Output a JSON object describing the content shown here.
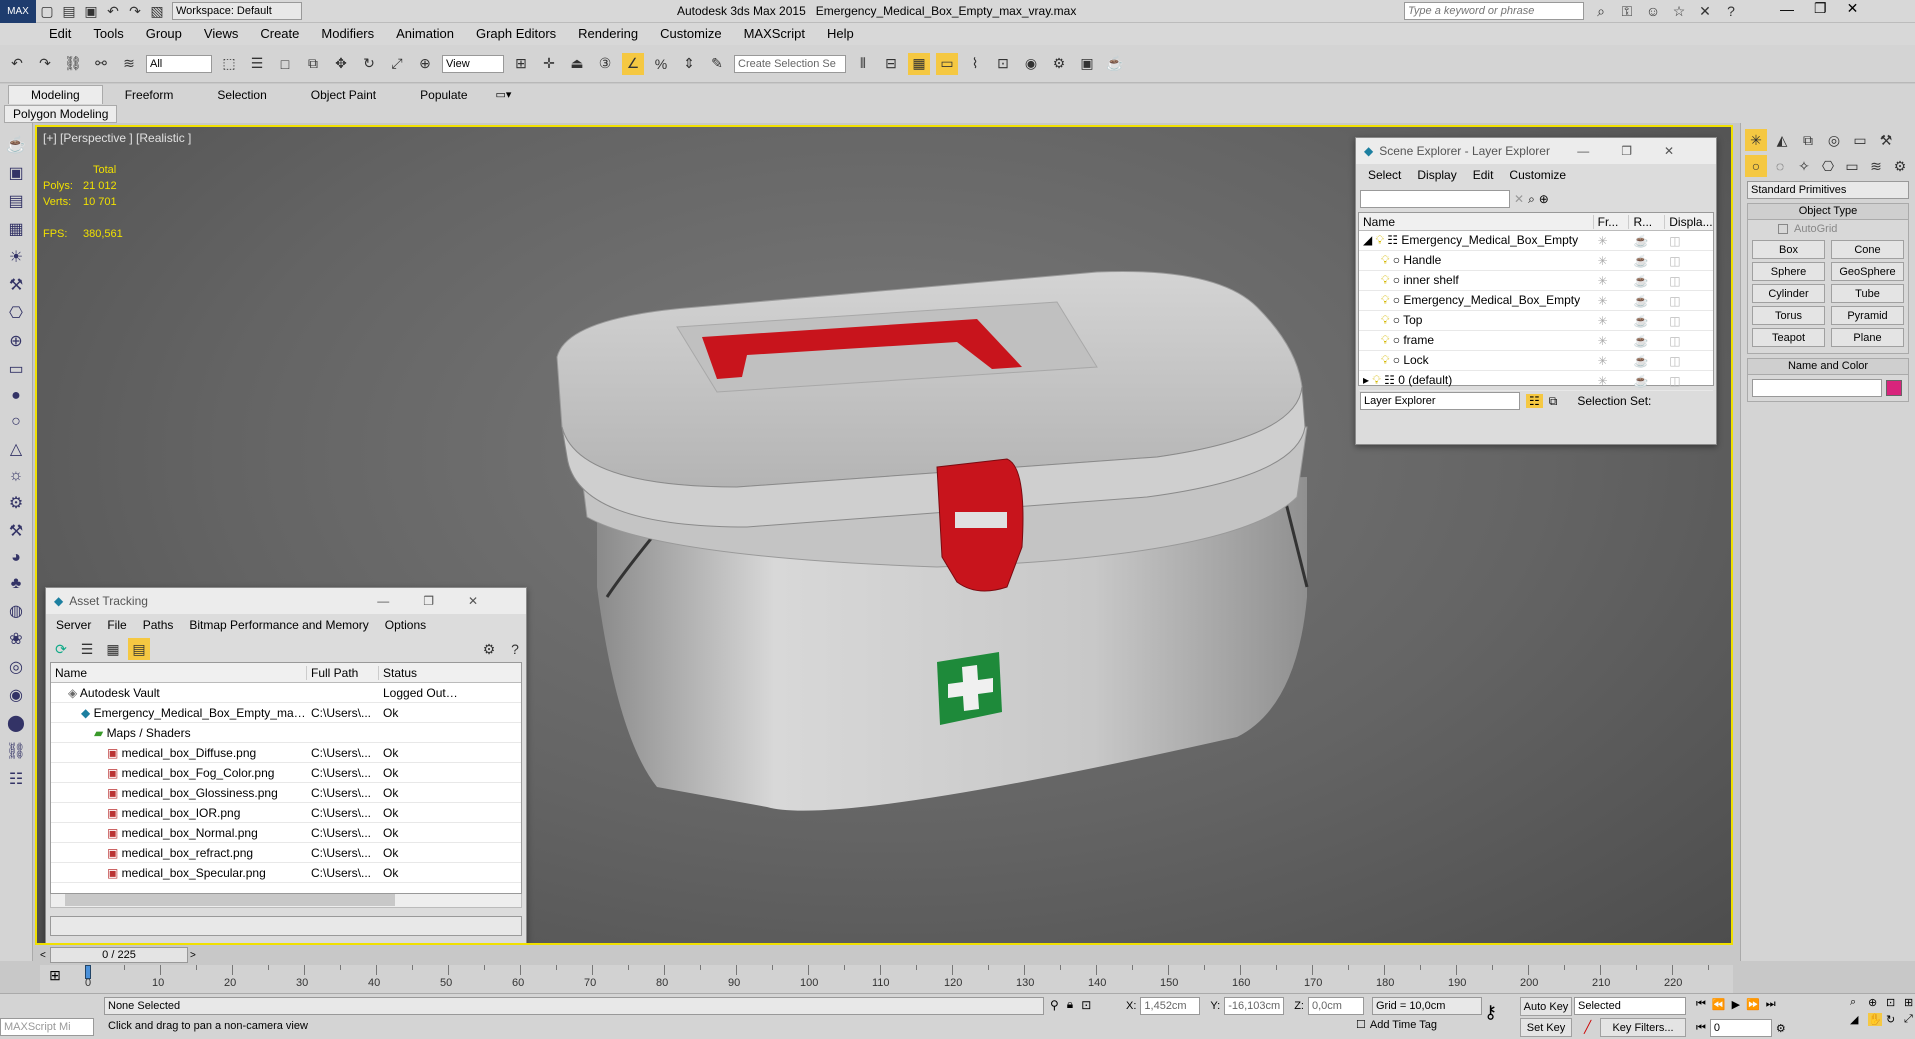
{
  "title_bar": {
    "workspace": "Workspace: Default",
    "app_title": "Autodesk 3ds Max  2015",
    "file_name": "Emergency_Medical_Box_Empty_max_vray.max",
    "search_placeholder": "Type a keyword or phrase"
  },
  "menu": [
    "Edit",
    "Tools",
    "Group",
    "Views",
    "Create",
    "Modifiers",
    "Animation",
    "Graph Editors",
    "Rendering",
    "Customize",
    "MAXScript",
    "Help"
  ],
  "main_toolbar": {
    "selection_filter": "All",
    "ref_coord": "View",
    "selection_set_placeholder": "Create Selection Se"
  },
  "ribbon": {
    "tabs": [
      "Modeling",
      "Freeform",
      "Selection",
      "Object Paint",
      "Populate"
    ],
    "subtab": "Polygon Modeling"
  },
  "viewport": {
    "label": "[+] [Perspective ] [Realistic ]",
    "stats": {
      "total_label": "Total",
      "polys_label": "Polys:",
      "polys": "21 012",
      "verts_label": "Verts:",
      "verts": "10 701",
      "fps_label": "FPS:",
      "fps": "380,561"
    }
  },
  "scene_explorer": {
    "title": "Scene Explorer - Layer Explorer",
    "menu": [
      "Select",
      "Display",
      "Edit",
      "Customize"
    ],
    "columns": [
      "Name",
      "Fr...",
      "R...",
      "Displa..."
    ],
    "rows": [
      {
        "name": "Emergency_Medical_Box_Empty",
        "level": 0
      },
      {
        "name": "Handle",
        "level": 1
      },
      {
        "name": "inner shelf",
        "level": 1
      },
      {
        "name": "Emergency_Medical_Box_Empty",
        "level": 1
      },
      {
        "name": "Top",
        "level": 1
      },
      {
        "name": "frame",
        "level": 1
      },
      {
        "name": "Lock",
        "level": 1
      },
      {
        "name": "0 (default)",
        "level": 0
      }
    ],
    "footer_dropdown": "Layer Explorer",
    "selection_set_label": "Selection Set:"
  },
  "asset_tracking": {
    "title": "Asset Tracking",
    "menu": [
      "Server",
      "File",
      "Paths",
      "Bitmap Performance and Memory",
      "Options"
    ],
    "columns": [
      "Name",
      "Full Path",
      "Status"
    ],
    "rows": [
      {
        "name": "Autodesk Vault",
        "path": "",
        "status": "Logged Out ...",
        "indent": 1
      },
      {
        "name": "Emergency_Medical_Box_Empty_max_vray.max",
        "path": "C:\\Users\\...",
        "status": "Ok",
        "indent": 2
      },
      {
        "name": "Maps / Shaders",
        "path": "",
        "status": "",
        "indent": 3
      },
      {
        "name": "medical_box_Diffuse.png",
        "path": "C:\\Users\\...",
        "status": "Ok",
        "indent": 4
      },
      {
        "name": "medical_box_Fog_Color.png",
        "path": "C:\\Users\\...",
        "status": "Ok",
        "indent": 4
      },
      {
        "name": "medical_box_Glossiness.png",
        "path": "C:\\Users\\...",
        "status": "Ok",
        "indent": 4
      },
      {
        "name": "medical_box_IOR.png",
        "path": "C:\\Users\\...",
        "status": "Ok",
        "indent": 4
      },
      {
        "name": "medical_box_Normal.png",
        "path": "C:\\Users\\...",
        "status": "Ok",
        "indent": 4
      },
      {
        "name": "medical_box_refract.png",
        "path": "C:\\Users\\...",
        "status": "Ok",
        "indent": 4
      },
      {
        "name": "medical_box_Specular.png",
        "path": "C:\\Users\\...",
        "status": "Ok",
        "indent": 4
      }
    ]
  },
  "command_panel": {
    "category": "Standard Primitives",
    "object_type_label": "Object Type",
    "autogrid": "AutoGrid",
    "buttons": [
      "Box",
      "Cone",
      "Sphere",
      "GeoSphere",
      "Cylinder",
      "Tube",
      "Torus",
      "Pyramid",
      "Teapot",
      "Plane"
    ],
    "name_color_label": "Name and Color",
    "object_color": "#d8247c"
  },
  "timeline": {
    "frame_counter": "0 / 225",
    "ticks": [
      "0",
      "10",
      "20",
      "30",
      "40",
      "50",
      "60",
      "70",
      "80",
      "90",
      "100",
      "110",
      "120",
      "130",
      "140",
      "150",
      "160",
      "170",
      "180",
      "190",
      "200",
      "210",
      "220"
    ]
  },
  "status": {
    "maxscript": "MAXScript Mi",
    "selection": "None Selected",
    "prompt": "Click and drag to pan a non-camera view",
    "x_label": "X:",
    "x": "1,452cm",
    "y_label": "Y:",
    "y": "-16,103cm",
    "z_label": "Z:",
    "z": "0,0cm",
    "grid": "Grid = 10,0cm",
    "add_time_tag": "Add Time Tag",
    "auto_key": "Auto Key",
    "set_key": "Set Key",
    "key_mode": "Selected",
    "key_filters": "Key Filters...",
    "frame": "0"
  },
  "colors": {
    "viewport_border": "#f0e000",
    "stats_text": "#f0e000",
    "box_red": "#c8141c",
    "cross_green": "#1e8a3a"
  }
}
